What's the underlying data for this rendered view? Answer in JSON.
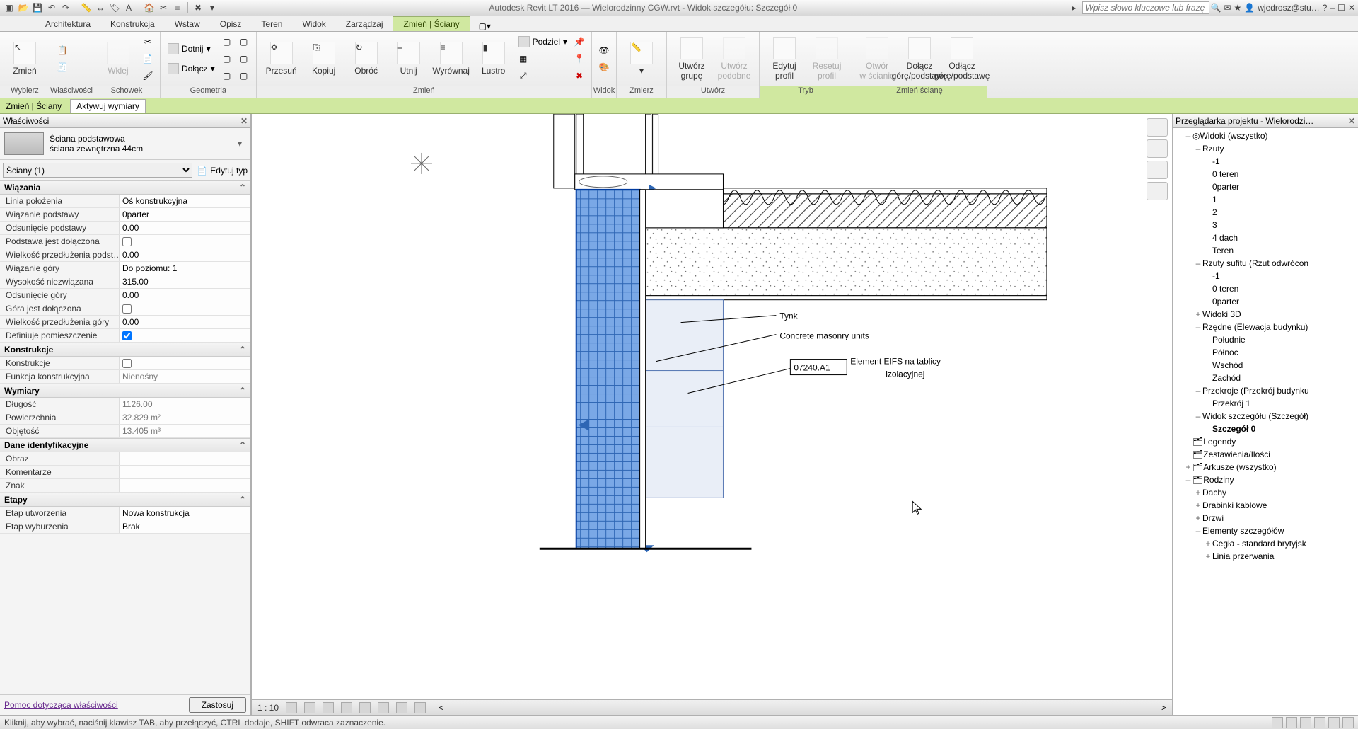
{
  "title": "Autodesk Revit LT 2016 — Wielorodzinny CGW.rvt - Widok szczegółu: Szczegół 0",
  "search_placeholder": "Wpisz słowo kluczowe lub frazę",
  "user": "wjedrosz@stu…",
  "ribbon_tabs": [
    "Architektura",
    "Konstrukcja",
    "Wstaw",
    "Opisz",
    "Teren",
    "Widok",
    "Zarządzaj",
    "Zmień | Ściany"
  ],
  "ribbon_active": 7,
  "groups": {
    "wybierz": "Wybierz",
    "wlasciwosci": "Właściwości",
    "schowek": "Schowek",
    "geometria": "Geometria",
    "zmien": "Zmień",
    "widok": "Widok",
    "zmierz": "Zmierz",
    "utworz": "Utwórz",
    "tryb": "Tryb",
    "sciana": "Zmień ścianę"
  },
  "cmds": {
    "zmien": "Zmień",
    "wklej": "Wklej",
    "dotnij": "Dotnij",
    "dolacz": "Dołącz",
    "przesun": "Przesuń",
    "kopiuj": "Kopiuj",
    "obroc": "Obróć",
    "utnij": "Utnij",
    "wyrownaj": "Wyrównaj",
    "lustro": "Lustro",
    "podziel": "Podziel",
    "utworz_grupe": "Utwórz\ngrupę",
    "utworz_podobne": "Utwórz\npodobne",
    "edytuj_profil": "Edytuj\nprofil",
    "resetuj_profil": "Resetuj\nprofil",
    "otworz_wscianie": "Otwór\nw ścianie",
    "dolacz_gp": "Dołącz\ngórę/podstawę",
    "odlacz_gp": "Odłącz\ngórę/podstawę"
  },
  "ctx": {
    "left": "Zmień | Ściany",
    "right": "Aktywuj wymiary"
  },
  "props_title": "Właściwości",
  "type_family": "Ściana podstawowa",
  "type_name": "ściana zewnętrzna 44cm",
  "filter": "Ściany (1)",
  "edit_type": "Edytuj typ",
  "propGroups": {
    "wiazania": "Wiązania",
    "konstrukcje": "Konstrukcje",
    "wymiary": "Wymiary",
    "dane": "Dane identyfikacyjne",
    "etapy": "Etapy"
  },
  "props": {
    "linia_polozenia": {
      "k": "Linia położenia",
      "v": "Oś konstrukcyjna"
    },
    "wiazanie_podstawy": {
      "k": "Wiązanie podstawy",
      "v": "0parter"
    },
    "odsun_podst": {
      "k": "Odsunięcie podstawy",
      "v": "0.00"
    },
    "podst_dol": {
      "k": "Podstawa jest dołączona",
      "v": false
    },
    "wielk_przedl_podst": {
      "k": "Wielkość przedłużenia podst…",
      "v": "0.00"
    },
    "wiazanie_gory": {
      "k": "Wiązanie góry",
      "v": "Do poziomu: 1"
    },
    "wys_niezw": {
      "k": "Wysokość niezwiązana",
      "v": "315.00"
    },
    "odsun_gory": {
      "k": "Odsunięcie góry",
      "v": "0.00"
    },
    "gora_dol": {
      "k": "Góra jest dołączona",
      "v": false
    },
    "wielk_przedl_gory": {
      "k": "Wielkość przedłużenia góry",
      "v": "0.00"
    },
    "def_pom": {
      "k": "Definiuje pomieszczenie",
      "v": true
    },
    "konstr": {
      "k": "Konstrukcje",
      "v": false
    },
    "funkcja": {
      "k": "Funkcja konstrukcyjna",
      "v": "Nienośny"
    },
    "dlugosc": {
      "k": "Długość",
      "v": "1126.00"
    },
    "pow": {
      "k": "Powierzchnia",
      "v": "32.829 m²"
    },
    "obj": {
      "k": "Objętość",
      "v": "13.405 m³"
    },
    "obraz": {
      "k": "Obraz",
      "v": ""
    },
    "koment": {
      "k": "Komentarze",
      "v": ""
    },
    "znak": {
      "k": "Znak",
      "v": ""
    },
    "etap_u": {
      "k": "Etap utworzenia",
      "v": "Nowa konstrukcja"
    },
    "etap_w": {
      "k": "Etap wyburzenia",
      "v": "Brak"
    }
  },
  "prop_help": "Pomoc dotycząca właściwości",
  "apply": "Zastosuj",
  "browser_title": "Przeglądarka projektu - Wielorodzi…",
  "tree": {
    "widoki": "Widoki (wszystko)",
    "rzuty": "Rzuty",
    "rzuty_items": [
      "-1",
      "0 teren",
      "0parter",
      "1",
      "2",
      "3",
      "4 dach",
      "Teren"
    ],
    "rzuty_sufitu": "Rzuty sufitu (Rzut odwrócon",
    "rzuty_sufitu_items": [
      "-1",
      "0 teren",
      "0parter"
    ],
    "widoki3d": "Widoki 3D",
    "rzedne": "Rzędne (Elewacja budynku)",
    "rzedne_items": [
      "Południe",
      "Północ",
      "Wschód",
      "Zachód"
    ],
    "przekroje": "Przekroje (Przekrój budynku",
    "przekroje_items": [
      "Przekrój 1"
    ],
    "widok_szcz": "Widok szczegółu (Szczegół)",
    "widok_szcz_items": [
      "Szczegół 0"
    ],
    "legendy": "Legendy",
    "zest": "Zestawienia/Ilości",
    "arkusze": "Arkusze (wszystko)",
    "rodziny": "Rodziny",
    "rodziny_items": [
      "Dachy",
      "Drabinki kablowe",
      "Drzwi",
      "Elementy szczegółów"
    ],
    "elem_items": [
      "Cegła - standard brytyjsk",
      "Linia przerwania"
    ]
  },
  "canvas_labels": {
    "tynk": "Tynk",
    "cmu": "Concrete masonry units",
    "keynote": "07240.A1",
    "eifs": "Element EIFS na tablicy\nizolacyjnej"
  },
  "scale": "1 : 10",
  "status": "Kliknij, aby wybrać, naciśnij klawisz TAB, aby przełączyć, CTRL dodaje, SHIFT odwraca zaznaczenie.",
  "chart_data": {
    "type": "diagram",
    "description": "Architectural wall section detail",
    "elements": [
      {
        "name": "selected wall",
        "material": "concrete masonry units",
        "state": "selected",
        "fill": "blue-grid"
      },
      {
        "name": "floor slab",
        "material": "concrete",
        "hatch": "stipple"
      },
      {
        "name": "insulation",
        "hatch": "zigzag"
      },
      {
        "name": "finish",
        "material": "Tynk"
      },
      {
        "name": "EIFS board",
        "keynote": "07240.A1"
      }
    ],
    "leaders": [
      {
        "text": "Tynk"
      },
      {
        "text": "Concrete masonry units"
      },
      {
        "text": "Element EIFS na tablicy izolacyjnej",
        "keynote": "07240.A1"
      }
    ]
  }
}
